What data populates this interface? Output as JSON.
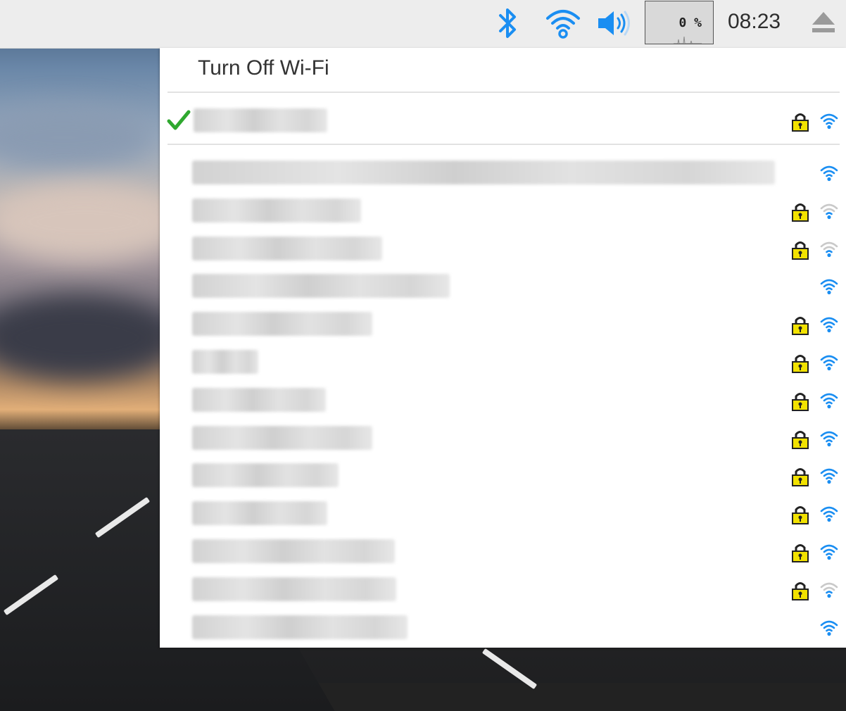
{
  "panel": {
    "cpu_usage": "0 %",
    "clock": "08:23",
    "icons": [
      "bluetooth-icon",
      "wifi-icon",
      "volume-icon",
      "cpu-monitor",
      "eject-icon"
    ]
  },
  "menu": {
    "turn_off_label": "Turn Off Wi-Fi",
    "connected_network": {
      "ssid": "",
      "secured": true,
      "signal": "full",
      "connected": true
    },
    "networks": [
      {
        "ssid": "",
        "secured": false,
        "signal": "full"
      },
      {
        "ssid": "",
        "secured": true,
        "signal": "low"
      },
      {
        "ssid": "",
        "secured": true,
        "signal": "low"
      },
      {
        "ssid": "",
        "secured": false,
        "signal": "full"
      },
      {
        "ssid": "",
        "secured": true,
        "signal": "full"
      },
      {
        "ssid": "",
        "secured": true,
        "signal": "full"
      },
      {
        "ssid": "",
        "secured": true,
        "signal": "full"
      },
      {
        "ssid": "",
        "secured": true,
        "signal": "full"
      },
      {
        "ssid": "",
        "secured": true,
        "signal": "full"
      },
      {
        "ssid": "",
        "secured": true,
        "signal": "full"
      },
      {
        "ssid": "",
        "secured": true,
        "signal": "full"
      },
      {
        "ssid": "",
        "secured": true,
        "signal": "low"
      },
      {
        "ssid": "",
        "secured": false,
        "signal": "full"
      }
    ]
  },
  "colors": {
    "accent": "#1a8ef2",
    "signal_inactive": "#c9c9c9",
    "lock": "#f2e200",
    "check": "#2fa82f"
  }
}
